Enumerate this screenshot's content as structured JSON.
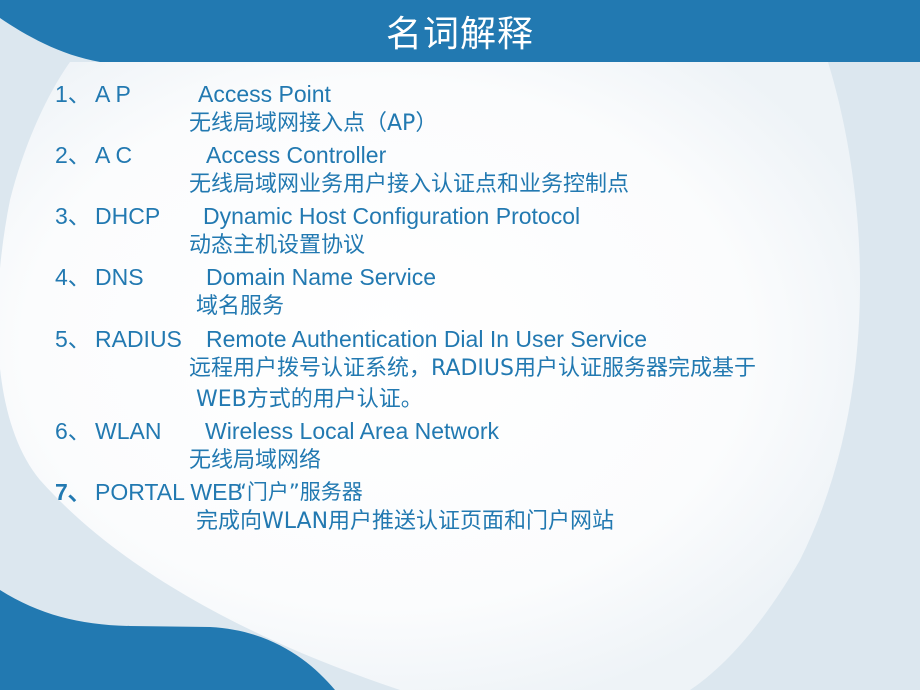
{
  "slide": {
    "title": "名词解释",
    "colors": {
      "header": "#2279b1",
      "text": "#2279b1",
      "accent_light": "#dce7ef",
      "background": "#ffffff"
    },
    "terms": [
      {
        "number": "1、",
        "abbr": "A P",
        "full": "Access Point",
        "desc": [
          "无线局域网接入点（AP）"
        ]
      },
      {
        "number": "2、",
        "abbr": "A C",
        "full": "Access Controller",
        "desc": [
          "无线局域网业务用户接入认证点和业务控制点"
        ]
      },
      {
        "number": "3、",
        "abbr": "DHCP",
        "full": "Dynamic Host Configuration Protocol",
        "desc": [
          "动态主机设置协议"
        ]
      },
      {
        "number": "4、",
        "abbr": "DNS",
        "full": "Domain Name Service",
        "desc": [
          "域名服务"
        ]
      },
      {
        "number": "5、",
        "abbr": "RADIUS",
        "full": "Remote Authentication Dial In User Service",
        "desc": [
          "远程用户拨号认证系统，RADIUS用户认证服务器完成基于",
          "WEB方式的用户认证。"
        ]
      },
      {
        "number": "6、",
        "abbr": "WLAN",
        "full": "Wireless Local Area Network",
        "desc": [
          "无线局域网络"
        ]
      },
      {
        "number": "7、",
        "abbr": "PORTAL WEB",
        "full": "“门户”服务器",
        "desc": [
          "完成向WLAN用户推送认证页面和门户网站"
        ]
      }
    ]
  }
}
